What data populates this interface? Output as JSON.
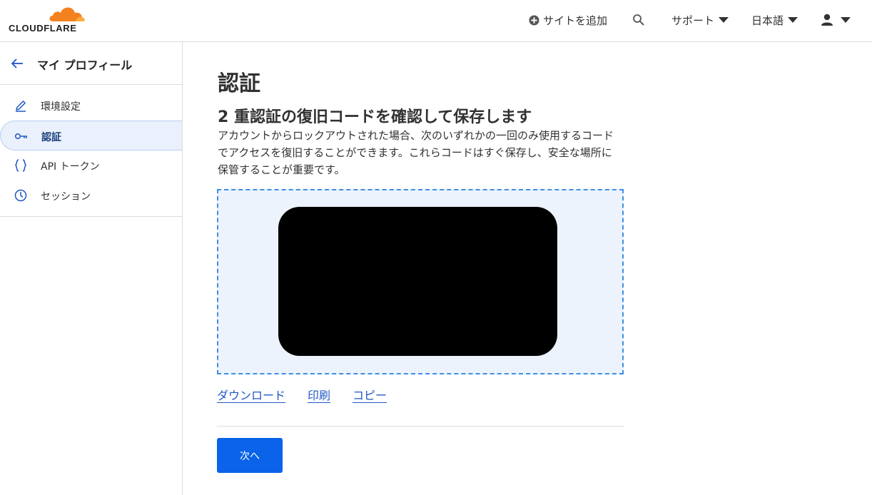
{
  "brand": {
    "name": "CLOUDFLARE",
    "cloud_colors": [
      "#f48120",
      "#faad3f"
    ]
  },
  "header": {
    "add_site": "サイトを追加",
    "add_icon": "plus-circle-icon",
    "search_icon": "search-icon",
    "support": "サポート",
    "language": "日本語",
    "user_icon": "user-icon"
  },
  "sidebar": {
    "title": "マイ プロフィール",
    "items": [
      {
        "label": "環境設定",
        "icon": "pencil-icon",
        "active": false
      },
      {
        "label": "認証",
        "icon": "key-icon",
        "active": true
      },
      {
        "label": "API トークン",
        "icon": "braces-icon",
        "active": false
      },
      {
        "label": "セッション",
        "icon": "clock-icon",
        "active": false
      }
    ]
  },
  "main": {
    "title": "認証",
    "section_title": "2 重認証の復旧コードを確認して保存します",
    "description": "アカウントからロックアウトされた場合、次のいずれかの一回のみ使用するコードでアクセスを復旧することができます。これらコードはすぐ保存し、安全な場所に保管することが重要です。",
    "links": {
      "download": "ダウンロード",
      "print": "印刷",
      "copy": "コピー"
    },
    "next_button": "次へ"
  },
  "colors": {
    "accent": "#0a63e8",
    "link": "#1f58c4",
    "codebox_bg": "#ecf3fd",
    "codebox_border": "#3f8ee6",
    "active_bg": "#eaf1fc"
  }
}
